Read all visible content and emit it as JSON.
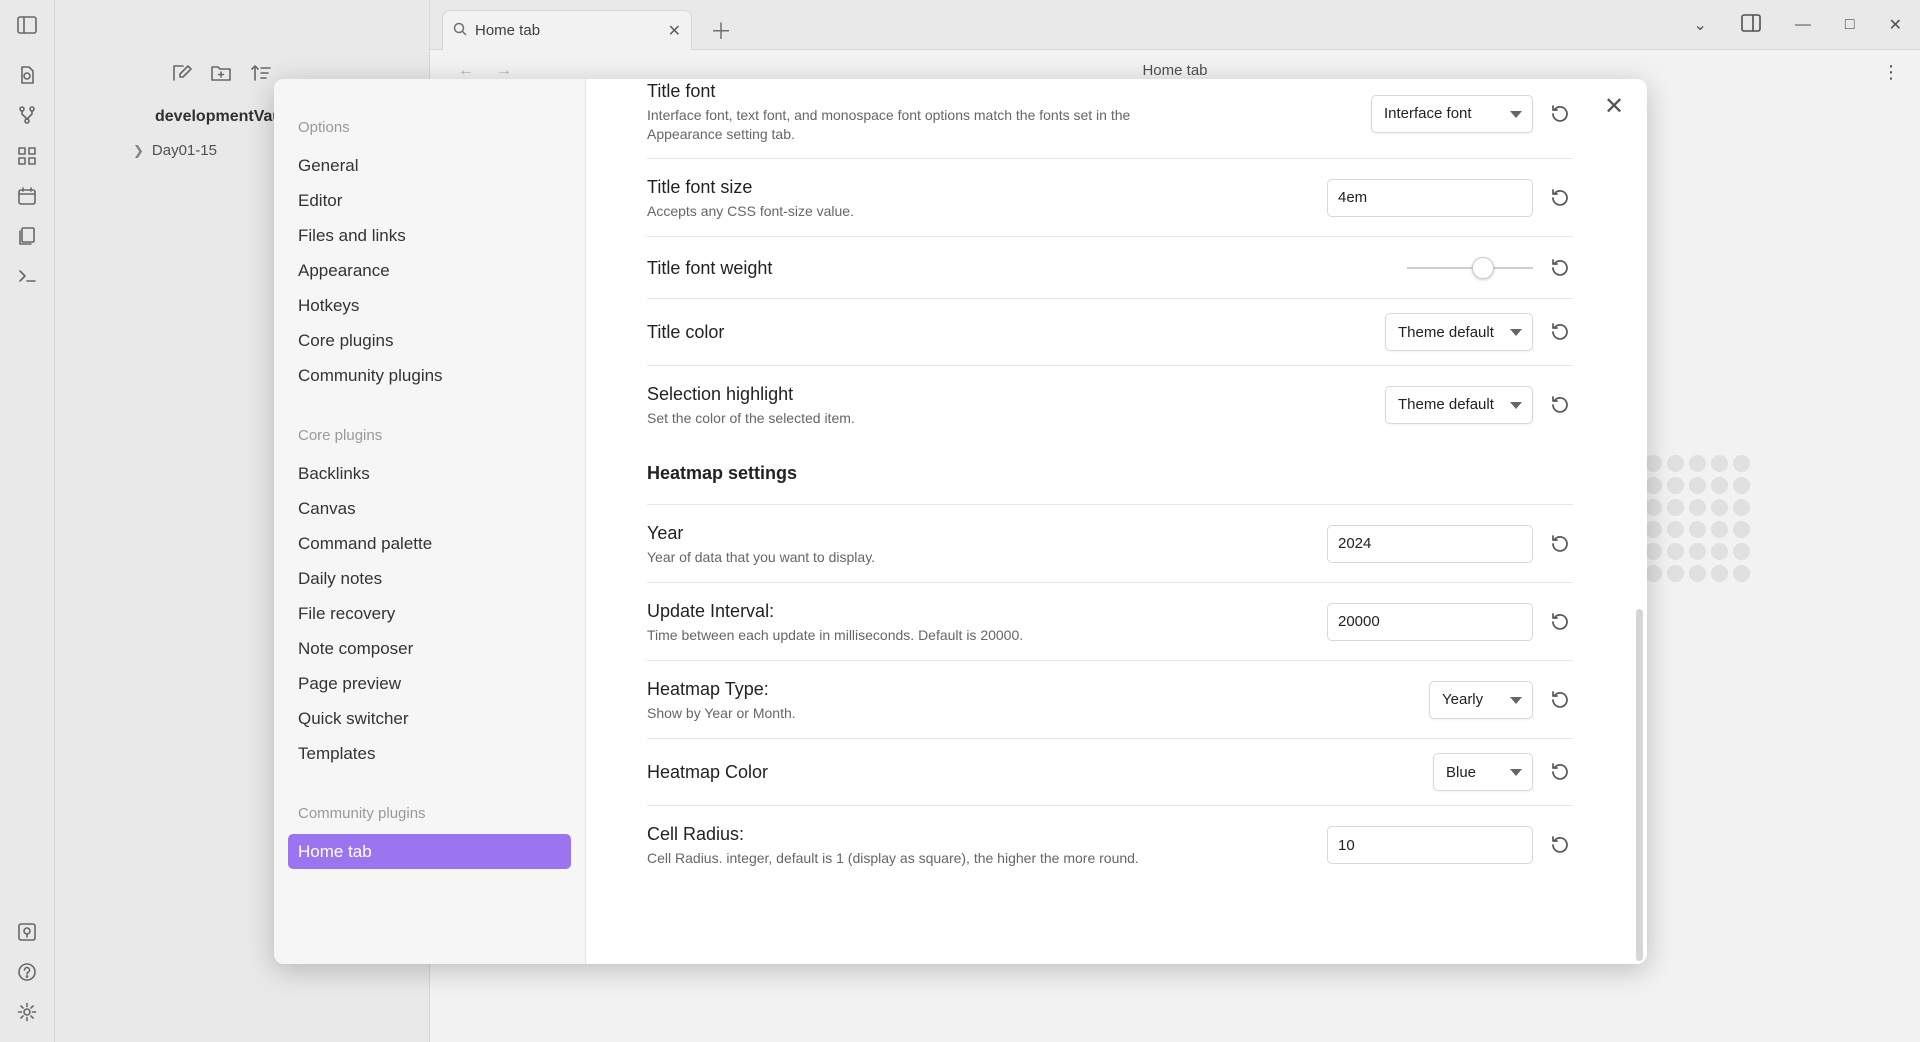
{
  "app": {
    "vault_name": "developmentVault",
    "tree_items": [
      "Day01-15"
    ],
    "tab_title": "Home tab",
    "view_title": "Home tab",
    "accent_color": "#9b74f0"
  },
  "settings_nav": {
    "options_heading": "Options",
    "options": [
      "General",
      "Editor",
      "Files and links",
      "Appearance",
      "Hotkeys",
      "Core plugins",
      "Community plugins"
    ],
    "core_heading": "Core plugins",
    "core": [
      "Backlinks",
      "Canvas",
      "Command palette",
      "Daily notes",
      "File recovery",
      "Note composer",
      "Page preview",
      "Quick switcher",
      "Templates"
    ],
    "community_heading": "Community plugins",
    "community": [
      "Home tab"
    ],
    "active": "Home tab"
  },
  "settings": {
    "title_font": {
      "name": "Title font",
      "desc": "Interface font, text font, and monospace font options match the fonts set in the Appearance setting tab.",
      "value": "Interface font"
    },
    "title_font_size": {
      "name": "Title font size",
      "desc": "Accepts any CSS font-size value.",
      "value": "4em"
    },
    "title_font_weight": {
      "name": "Title font weight",
      "level_fraction": 0.6
    },
    "title_color": {
      "name": "Title color",
      "value": "Theme default"
    },
    "selection_highlight": {
      "name": "Selection highlight",
      "desc": "Set the color of the selected item.",
      "value": "Theme default"
    },
    "heatmap_heading": "Heatmap settings",
    "year": {
      "name": "Year",
      "desc": "Year of data that you want to display.",
      "value": "2024"
    },
    "update_interval": {
      "name": "Update Interval:",
      "desc": "Time between each update in milliseconds. Default is 20000.",
      "value": "20000"
    },
    "heatmap_type": {
      "name": "Heatmap Type:",
      "desc": "Show by Year or Month.",
      "value": "Yearly"
    },
    "heatmap_color": {
      "name": "Heatmap Color",
      "value": "Blue"
    },
    "cell_radius": {
      "name": "Cell Radius:",
      "desc": "Cell Radius. integer, default is 1 (display as square), the higher the more round.",
      "value": "10"
    }
  }
}
